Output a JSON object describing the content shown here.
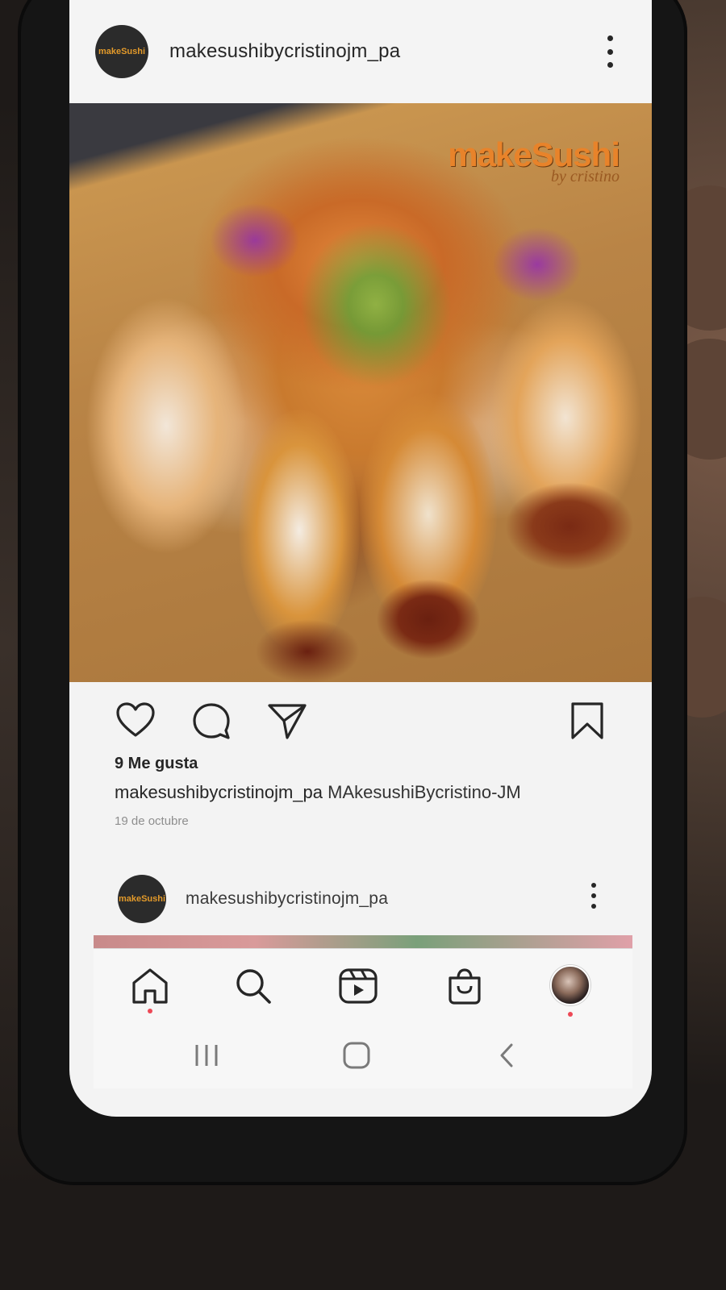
{
  "post": {
    "username": "makesushibycristinojm_pa",
    "avatar_text": "makeSushi",
    "likes": "9 Me gusta",
    "caption_user": "makesushibycristinojm_pa",
    "caption_text": "MAkesushiBycristino-JM",
    "date": "19 de octubre",
    "watermark_main": "makeSushi",
    "watermark_sub": "by cristino"
  },
  "next_post": {
    "username": "makesushibycristinojm_pa",
    "avatar_text": "makeSushi"
  },
  "actions": {
    "icons": [
      "heart-icon",
      "comment-icon",
      "share-icon",
      "bookmark-icon"
    ]
  },
  "bottom_nav": {
    "icons": [
      "home-icon",
      "search-icon",
      "reels-icon",
      "shop-icon",
      "profile-avatar"
    ]
  },
  "system_nav": {
    "icons": [
      "recents-icon",
      "home-button-icon",
      "back-icon"
    ]
  },
  "colors": {
    "text": "#262626",
    "muted": "#8e8e8e",
    "notification_dot": "#ed4956",
    "brand_orange": "#e8832a"
  }
}
